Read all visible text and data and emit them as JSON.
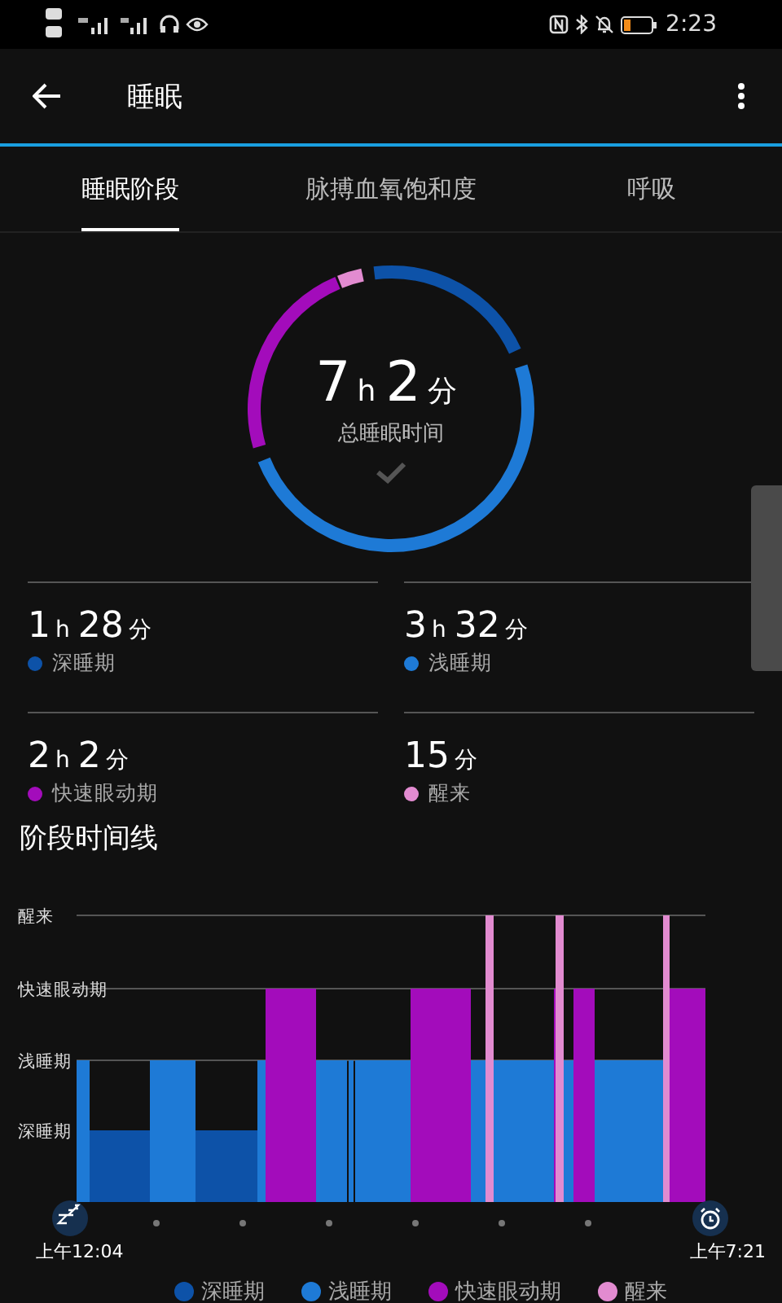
{
  "status_bar": {
    "time": "2:23"
  },
  "app_bar": {
    "title": "睡眠"
  },
  "tabs": [
    {
      "label": "睡眠阶段",
      "selected": true
    },
    {
      "label": "脉搏血氧饱和度",
      "selected": false
    },
    {
      "label": "呼吸",
      "selected": false
    }
  ],
  "summary": {
    "value": [
      {
        "text": "7",
        "kind": "num"
      },
      {
        "text": "h",
        "kind": "unit"
      },
      {
        "text": "2",
        "kind": "num"
      },
      {
        "text": "分",
        "kind": "unit"
      }
    ],
    "label": "总睡眠时间"
  },
  "stats": [
    {
      "value": [
        {
          "text": "1",
          "kind": "num"
        },
        {
          "text": "h",
          "kind": "unit"
        },
        {
          "text": "28",
          "kind": "num"
        },
        {
          "text": "分",
          "kind": "unit"
        }
      ],
      "label": "深睡期",
      "color": "#0d52a8"
    },
    {
      "value": [
        {
          "text": "3",
          "kind": "num"
        },
        {
          "text": "h",
          "kind": "unit"
        },
        {
          "text": "32",
          "kind": "num"
        },
        {
          "text": "分",
          "kind": "unit"
        }
      ],
      "label": "浅睡期",
      "color": "#1e7ad6"
    },
    {
      "value": [
        {
          "text": "2",
          "kind": "num"
        },
        {
          "text": "h",
          "kind": "unit"
        },
        {
          "text": "2",
          "kind": "num"
        },
        {
          "text": "分",
          "kind": "unit"
        }
      ],
      "label": "快速眼动期",
      "color": "#a30cbb"
    },
    {
      "value": [
        {
          "text": "15",
          "kind": "num"
        },
        {
          "text": "分",
          "kind": "unit"
        }
      ],
      "label": "醒来",
      "color": "#e28bd0"
    }
  ],
  "timeline": {
    "title": "阶段时间线",
    "y_labels": [
      "醒来",
      "快速眼动期",
      "浅睡期",
      "深睡期"
    ],
    "start": "上午12:04",
    "end": "上午7:21"
  },
  "legend": [
    {
      "label": "深睡期",
      "color": "#0d52a8"
    },
    {
      "label": "浅睡期",
      "color": "#1e7ad6"
    },
    {
      "label": "快速眼动期",
      "color": "#a30cbb"
    },
    {
      "label": "醒来",
      "color": "#e28bd0"
    }
  ]
}
